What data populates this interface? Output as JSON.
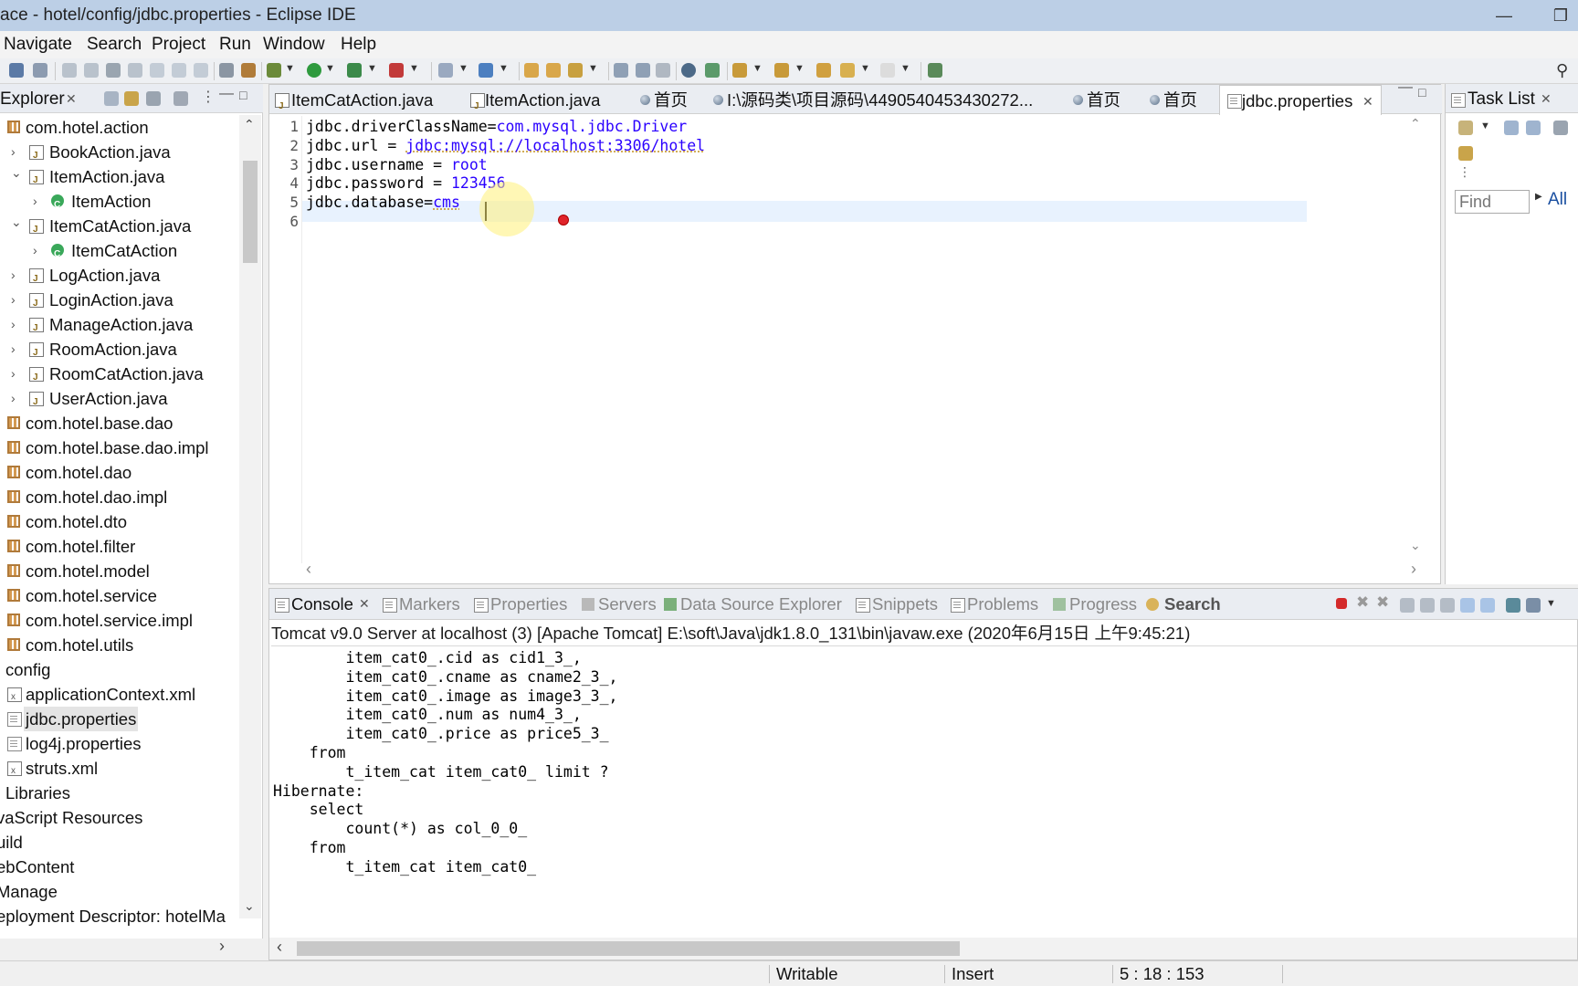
{
  "window": {
    "title": "ace - hotel/config/jdbc.properties - Eclipse IDE"
  },
  "menu": [
    "Navigate",
    "Search",
    "Project",
    "Run",
    "Window",
    "Help"
  ],
  "explorer": {
    "title": "Explorer",
    "items": [
      {
        "label": "com.hotel.action",
        "icon": "package-icon",
        "level": 0,
        "chevron": "none"
      },
      {
        "label": "BookAction.java",
        "icon": "java-file-icon",
        "level": 1,
        "chevron": "right"
      },
      {
        "label": "ItemAction.java",
        "icon": "java-file-icon",
        "level": 1,
        "chevron": "down"
      },
      {
        "label": "ItemAction",
        "icon": "class-icon",
        "level": 2,
        "chevron": "right"
      },
      {
        "label": "ItemCatAction.java",
        "icon": "java-file-icon",
        "level": 1,
        "chevron": "down"
      },
      {
        "label": "ItemCatAction",
        "icon": "class-icon",
        "level": 2,
        "chevron": "right"
      },
      {
        "label": "LogAction.java",
        "icon": "java-file-icon",
        "level": 1,
        "chevron": "right"
      },
      {
        "label": "LoginAction.java",
        "icon": "java-file-icon",
        "level": 1,
        "chevron": "right"
      },
      {
        "label": "ManageAction.java",
        "icon": "java-file-icon",
        "level": 1,
        "chevron": "right"
      },
      {
        "label": "RoomAction.java",
        "icon": "java-file-icon",
        "level": 1,
        "chevron": "right"
      },
      {
        "label": "RoomCatAction.java",
        "icon": "java-file-icon",
        "level": 1,
        "chevron": "right"
      },
      {
        "label": "UserAction.java",
        "icon": "java-file-icon",
        "level": 1,
        "chevron": "right"
      },
      {
        "label": "com.hotel.base.dao",
        "icon": "package-icon",
        "level": 0,
        "chevron": "none"
      },
      {
        "label": "com.hotel.base.dao.impl",
        "icon": "package-icon",
        "level": 0,
        "chevron": "none"
      },
      {
        "label": "com.hotel.dao",
        "icon": "package-icon",
        "level": 0,
        "chevron": "none"
      },
      {
        "label": "com.hotel.dao.impl",
        "icon": "package-icon",
        "level": 0,
        "chevron": "none"
      },
      {
        "label": "com.hotel.dto",
        "icon": "package-icon",
        "level": 0,
        "chevron": "none"
      },
      {
        "label": "com.hotel.filter",
        "icon": "package-icon",
        "level": 0,
        "chevron": "none"
      },
      {
        "label": "com.hotel.model",
        "icon": "package-icon",
        "level": 0,
        "chevron": "none"
      },
      {
        "label": "com.hotel.service",
        "icon": "package-icon",
        "level": 0,
        "chevron": "none"
      },
      {
        "label": "com.hotel.service.impl",
        "icon": "package-icon",
        "level": 0,
        "chevron": "none"
      },
      {
        "label": "com.hotel.utils",
        "icon": "package-icon",
        "level": 0,
        "chevron": "none"
      },
      {
        "label": "config",
        "icon": "none",
        "level": -1,
        "chevron": "none"
      },
      {
        "label": "applicationContext.xml",
        "icon": "xml-file-icon",
        "level": 0,
        "chevron": "none"
      },
      {
        "label": "jdbc.properties",
        "icon": "properties-file-icon",
        "level": 0,
        "chevron": "none",
        "selected": true
      },
      {
        "label": "log4j.properties",
        "icon": "properties-file-icon",
        "level": 0,
        "chevron": "none"
      },
      {
        "label": "struts.xml",
        "icon": "xml-file-icon",
        "level": 0,
        "chevron": "none"
      },
      {
        "label": "Libraries",
        "icon": "none",
        "level": -1,
        "chevron": "none"
      },
      {
        "label": "vaScript Resources",
        "icon": "none",
        "level": -2,
        "chevron": "none"
      },
      {
        "label": "uild",
        "icon": "none",
        "level": -2,
        "chevron": "none"
      },
      {
        "label": "ebContent",
        "icon": "none",
        "level": -2,
        "chevron": "none"
      },
      {
        "label": "Manage",
        "icon": "none",
        "level": -2,
        "chevron": "none"
      },
      {
        "label": "eployment Descriptor: hotelMa",
        "icon": "none",
        "level": -2,
        "chevron": "none"
      }
    ]
  },
  "editor": {
    "tabs": [
      {
        "label": "ItemCatAction.java",
        "icon": "java-file-icon"
      },
      {
        "label": "ItemAction.java",
        "icon": "java-file-icon"
      },
      {
        "label": "首页",
        "icon": "globe-icon"
      },
      {
        "label": "I:\\源码类\\项目源码\\4490540453430272...",
        "icon": "globe-icon"
      },
      {
        "label": "首页",
        "icon": "globe-icon"
      },
      {
        "label": "首页",
        "icon": "globe-icon"
      },
      {
        "label": "jdbc.properties",
        "icon": "properties-file-icon",
        "active": true
      }
    ],
    "lines": [
      {
        "num": "1",
        "key": "jdbc.driverClassName=",
        "value": "com.mysql.jdbc.Driver"
      },
      {
        "num": "2",
        "key": "jdbc.url = ",
        "value": "jdbc:mysql://localhost:3306/hotel"
      },
      {
        "num": "3",
        "key": "jdbc.username = ",
        "value": "root"
      },
      {
        "num": "4",
        "key": "jdbc.password = ",
        "value": "123456"
      },
      {
        "num": "5",
        "key": "jdbc.database=",
        "value": "cms"
      },
      {
        "num": "6",
        "key": "",
        "value": ""
      }
    ]
  },
  "tasklist": {
    "title": "Task List",
    "find_placeholder": "Find",
    "all_label": "All"
  },
  "console": {
    "tabs": [
      {
        "label": "Console",
        "active": true
      },
      {
        "label": "Markers"
      },
      {
        "label": "Properties"
      },
      {
        "label": "Servers"
      },
      {
        "label": "Data Source Explorer"
      },
      {
        "label": "Snippets"
      },
      {
        "label": "Problems"
      },
      {
        "label": "Progress"
      },
      {
        "label": "Search",
        "bold": true
      }
    ],
    "header": "Tomcat v9.0 Server at localhost (3) [Apache Tomcat] E:\\soft\\Java\\jdk1.8.0_131\\bin\\javaw.exe  (2020年6月15日 上午9:45:21)",
    "output": [
      "        item_cat0_.cid as cid1_3_,",
      "        item_cat0_.cname as cname2_3_,",
      "        item_cat0_.image as image3_3_,",
      "        item_cat0_.num as num4_3_,",
      "        item_cat0_.price as price5_3_",
      "    from",
      "        t_item_cat item_cat0_ limit ?",
      "Hibernate: ",
      "    select",
      "        count(*) as col_0_0_",
      "    from",
      "        t_item_cat item_cat0_"
    ]
  },
  "status": {
    "writable": "Writable",
    "insert": "Insert",
    "position": "5 : 18 : 153"
  }
}
